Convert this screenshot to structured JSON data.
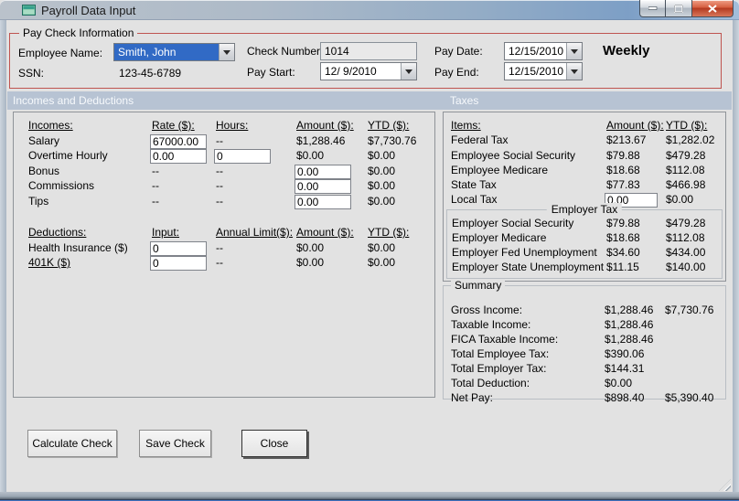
{
  "window": {
    "title": "Payroll Data Input"
  },
  "paycheck": {
    "legend": "Pay Check Information",
    "employee_name": {
      "label": "Employee Name:",
      "value": "Smith, John"
    },
    "ssn": {
      "label": "SSN:",
      "value": "123-45-6789"
    },
    "check_number": {
      "label": "Check Number:",
      "value": "1014"
    },
    "pay_start": {
      "label": "Pay Start:",
      "value": "12/ 9/2010"
    },
    "pay_date": {
      "label": "Pay Date:",
      "value": "12/15/2010"
    },
    "pay_end": {
      "label": "Pay End:",
      "value": "12/15/2010"
    },
    "frequency": "Weekly"
  },
  "section_bar": {
    "left": "Incomes and Deductions",
    "right": "Taxes"
  },
  "incomes": {
    "headers": {
      "item": "Incomes:",
      "rate": "Rate ($):",
      "hours": "Hours:",
      "amount": "Amount ($):",
      "ytd": "YTD ($):"
    },
    "rows": [
      {
        "label": "Salary",
        "rate": "67000.00",
        "hours": "--",
        "amount": "$1,288.46",
        "ytd": "$7,730.76"
      },
      {
        "label": "Overtime Hourly",
        "rate": "0.00",
        "hours": "0",
        "amount": "$0.00",
        "ytd": "$0.00"
      },
      {
        "label": "Bonus",
        "rate": "--",
        "hours": "--",
        "amount": "0.00",
        "ytd": "$0.00"
      },
      {
        "label": "Commissions",
        "rate": "--",
        "hours": "--",
        "amount": "0.00",
        "ytd": "$0.00"
      },
      {
        "label": "Tips",
        "rate": "--",
        "hours": "--",
        "amount": "0.00",
        "ytd": "$0.00"
      }
    ]
  },
  "deductions": {
    "headers": {
      "item": "Deductions:",
      "input": "Input:",
      "limit": "Annual Limit($):",
      "amount": "Amount ($):",
      "ytd": "YTD ($):"
    },
    "rows": [
      {
        "label": "Health Insurance ($)",
        "input": "0",
        "limit": "--",
        "amount": "$0.00",
        "ytd": "$0.00"
      },
      {
        "label": "401K ($)",
        "input": "0",
        "limit": "--",
        "amount": "$0.00",
        "ytd": "$0.00"
      }
    ]
  },
  "taxes": {
    "headers": {
      "item": "Items:",
      "amount": "Amount ($):",
      "ytd": "YTD ($):"
    },
    "rows": [
      {
        "label": "Federal Tax",
        "amount": "$213.67",
        "ytd": "$1,282.02"
      },
      {
        "label": "Employee Social Security",
        "amount": "$79.88",
        "ytd": "$479.28"
      },
      {
        "label": "Employee Medicare",
        "amount": "$18.68",
        "ytd": "$112.08"
      },
      {
        "label": "State Tax",
        "amount": "$77.83",
        "ytd": "$466.98"
      },
      {
        "label": "Local Tax",
        "amount": "0.00",
        "ytd": "$0.00"
      }
    ],
    "employer": {
      "legend": "Employer Tax",
      "rows": [
        {
          "label": "Employer Social Security",
          "amount": "$79.88",
          "ytd": "$479.28"
        },
        {
          "label": "Employer Medicare",
          "amount": "$18.68",
          "ytd": "$112.08"
        },
        {
          "label": "Employer Fed Unemployment",
          "amount": "$34.60",
          "ytd": "$434.00"
        },
        {
          "label": "Employer State Unemployment",
          "amount": "$11.15",
          "ytd": "$140.00"
        }
      ]
    }
  },
  "summary": {
    "legend": "Summary",
    "rows": [
      {
        "label": "Gross Income:",
        "amount": "$1,288.46",
        "ytd": "$7,730.76"
      },
      {
        "label": "Taxable Income:",
        "amount": "$1,288.46",
        "ytd": ""
      },
      {
        "label": "FICA Taxable Income:",
        "amount": "$1,288.46",
        "ytd": ""
      },
      {
        "label": "Total Employee Tax:",
        "amount": "$390.06",
        "ytd": ""
      },
      {
        "label": "Total Employer Tax:",
        "amount": "$144.31",
        "ytd": ""
      },
      {
        "label": "Total Deduction:",
        "amount": "$0.00",
        "ytd": ""
      },
      {
        "label": "Net Pay:",
        "amount": "$898.40",
        "ytd": "$5,390.40"
      }
    ]
  },
  "buttons": {
    "calculate": "Calculate Check",
    "save": "Save Check",
    "close": "Close"
  }
}
